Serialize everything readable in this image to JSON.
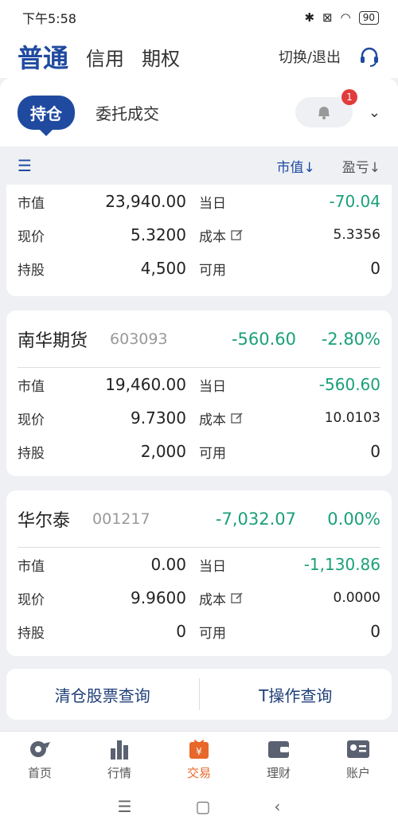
{
  "status": {
    "time": "下午5:58",
    "battery": "90"
  },
  "header": {
    "tabs": [
      "普通",
      "信用",
      "期权"
    ],
    "switch_label": "切换/退出"
  },
  "subtabs": {
    "active": "持仓",
    "other": "委托成交",
    "badge": "1"
  },
  "sortbar": {
    "market_value": "市值↓",
    "profit_loss": "盈亏↓"
  },
  "labels": {
    "mv": "市值",
    "today": "当日",
    "price": "现价",
    "cost": "成本",
    "shares": "持股",
    "available": "可用"
  },
  "holdings": [
    {
      "name": "",
      "code": "",
      "pl": "",
      "pct": "",
      "mv": "23,940.00",
      "today": "-70.04",
      "price": "5.3200",
      "cost": "5.3356",
      "shares": "4,500",
      "available": "0"
    },
    {
      "name": "南华期货",
      "code": "603093",
      "pl": "-560.60",
      "pct": "-2.80%",
      "mv": "19,460.00",
      "today": "-560.60",
      "price": "9.7300",
      "cost": "10.0103",
      "shares": "2,000",
      "available": "0"
    },
    {
      "name": "华尔泰",
      "code": "001217",
      "pl": "-7,032.07",
      "pct": "0.00%",
      "mv": "0.00",
      "today": "-1,130.86",
      "price": "9.9600",
      "cost": "0.0000",
      "shares": "0",
      "available": "0"
    }
  ],
  "buttons": {
    "cleared": "清仓股票查询",
    "t_ops": "T操作查询"
  },
  "nav": [
    {
      "label": "首页",
      "icon": "home-icon"
    },
    {
      "label": "行情",
      "icon": "chart-icon"
    },
    {
      "label": "交易",
      "icon": "trade-icon"
    },
    {
      "label": "理财",
      "icon": "wallet-icon"
    },
    {
      "label": "账户",
      "icon": "account-icon"
    }
  ],
  "colors": {
    "brand": "#1f4aa0",
    "loss": "#1aa079",
    "active_nav": "#e8672a"
  }
}
